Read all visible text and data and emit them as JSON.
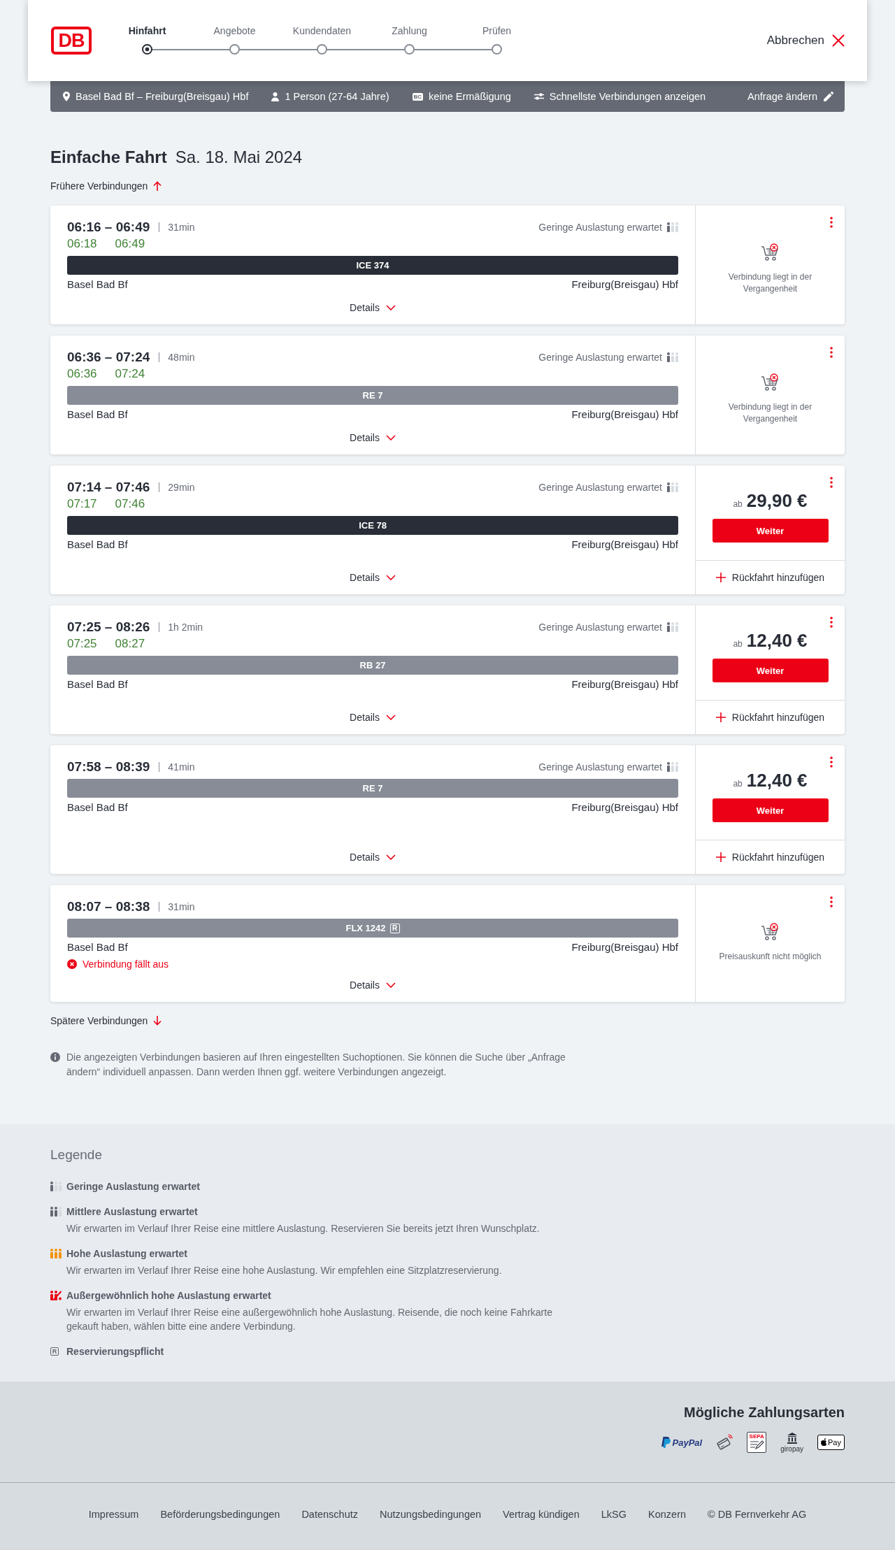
{
  "header": {
    "logo": "DB",
    "steps": [
      {
        "label": "Hinfahrt",
        "selected": true
      },
      {
        "label": "Angebote",
        "selected": false
      },
      {
        "label": "Kundendaten",
        "selected": false
      },
      {
        "label": "Zahlung",
        "selected": false
      },
      {
        "label": "Prüfen",
        "selected": false
      }
    ],
    "cancel": "Abbrechen"
  },
  "search_summary": {
    "route": "Basel Bad Bf – Freiburg(Breisgau) Hbf",
    "travellers": "1 Person (27-64 Jahre)",
    "discount_badge": "BC",
    "discount": "keine Ermäßigung",
    "option": "Schnellste Verbindungen anzeigen",
    "edit": "Anfrage ändern"
  },
  "title": "Einfache Fahrt",
  "date": "Sa. 18. Mai 2024",
  "earlier": "Frühere Verbindungen",
  "connections": [
    {
      "times": "06:16 – 06:49",
      "duration": "31min",
      "realtime": [
        "06:18",
        "06:49"
      ],
      "occupancy": {
        "kind": "low",
        "label": "Geringe Auslastung erwartet"
      },
      "train": {
        "name": "ICE 374",
        "color": "#282d37"
      },
      "from": "Basel Bad Bf",
      "to": "Freiburg(Breisgau) Hbf",
      "details": "Details",
      "offer": {
        "kind": "message",
        "text": "Verbindung liegt in der Vergangenheit"
      }
    },
    {
      "times": "06:36 – 07:24",
      "duration": "48min",
      "realtime": [
        "06:36",
        "07:24"
      ],
      "occupancy": {
        "kind": "low",
        "label": "Geringe Auslastung erwartet"
      },
      "train": {
        "name": "RE 7",
        "color": "#878c96"
      },
      "from": "Basel Bad Bf",
      "to": "Freiburg(Breisgau) Hbf",
      "details": "Details",
      "offer": {
        "kind": "message",
        "text": "Verbindung liegt in der Vergangenheit"
      }
    },
    {
      "times": "07:14 – 07:46",
      "duration": "29min",
      "realtime": [
        "07:17",
        "07:46"
      ],
      "occupancy": {
        "kind": "low",
        "label": "Geringe Auslastung erwartet"
      },
      "train": {
        "name": "ICE 78",
        "color": "#282d37"
      },
      "from": "Basel Bad Bf",
      "to": "Freiburg(Breisgau) Hbf",
      "details": "Details",
      "offer": {
        "kind": "price",
        "prefix": "ab",
        "price": "29,90 €",
        "button": "Weiter",
        "return_trip": "Rückfahrt hinzufügen"
      }
    },
    {
      "times": "07:25 – 08:26",
      "duration": "1h 2min",
      "realtime": [
        "07:25",
        "08:27"
      ],
      "occupancy": {
        "kind": "low",
        "label": "Geringe Auslastung erwartet"
      },
      "train": {
        "name": "RB 27",
        "color": "#878c96"
      },
      "from": "Basel Bad Bf",
      "to": "Freiburg(Breisgau) Hbf",
      "details": "Details",
      "offer": {
        "kind": "price",
        "prefix": "ab",
        "price": "12,40 €",
        "button": "Weiter",
        "return_trip": "Rückfahrt hinzufügen"
      }
    },
    {
      "times": "07:58 – 08:39",
      "duration": "41min",
      "occupancy": {
        "kind": "low",
        "label": "Geringe Auslastung erwartet"
      },
      "train": {
        "name": "RE 7",
        "color": "#878c96"
      },
      "from": "Basel Bad Bf",
      "to": "Freiburg(Breisgau) Hbf",
      "details": "Details",
      "offer": {
        "kind": "price",
        "prefix": "ab",
        "price": "12,40 €",
        "button": "Weiter",
        "return_trip": "Rückfahrt hinzufügen"
      }
    },
    {
      "times": "08:07 – 08:38",
      "duration": "31min",
      "train": {
        "name": "FLX 1242",
        "color": "#878c96",
        "reservation_mark": "R"
      },
      "from": "Basel Bad Bf",
      "to": "Freiburg(Breisgau) Hbf",
      "notice": "Verbindung fällt aus",
      "details": "Details",
      "offer": {
        "kind": "message",
        "text": "Preisauskunft nicht möglich"
      }
    }
  ],
  "later": "Spätere Verbindungen",
  "note": "Die angezeigten Verbindungen basieren auf Ihren eingestellten Suchoptionen. Sie können die Suche über „Anfrage ändern“ individuell anpassen. Dann werden Ihnen ggf. weitere Verbindungen angezeigt.",
  "legend": {
    "title": "Legende",
    "items": [
      {
        "kind": "low",
        "title": "Geringe Auslastung erwartet"
      },
      {
        "kind": "medium",
        "title": "Mittlere Auslastung erwartet",
        "description": "Wir erwarten im Verlauf Ihrer Reise eine mittlere Auslastung. Reservieren Sie bereits jetzt Ihren Wunschplatz."
      },
      {
        "kind": "high",
        "title": "Hohe Auslastung erwartet",
        "description": "Wir erwarten im Verlauf Ihrer Reise eine hohe Auslastung. Wir empfehlen eine Sitzplatzreservierung."
      },
      {
        "kind": "extreme",
        "title": "Außergewöhnlich hohe Auslastung erwartet",
        "description": "Wir erwarten im Verlauf Ihrer Reise eine außergewöhnlich hohe Auslastung. Reisende, die noch keine Fahrkarte gekauft haben, wählen bitte eine andere Verbindung."
      },
      {
        "kind": "reservation",
        "icon_text": "R",
        "title": "Reservierungspflicht"
      }
    ]
  },
  "payment": {
    "title": "Mögliche Zahlungsarten",
    "methods": [
      {
        "kind": "paypal",
        "label": "PayPal"
      },
      {
        "kind": "card"
      },
      {
        "kind": "sepa",
        "label": "SEPA"
      },
      {
        "kind": "giropay",
        "label": "giropay"
      },
      {
        "kind": "applepay",
        "label": "Pay"
      }
    ]
  },
  "footer_links": [
    "Impressum",
    "Beförderungsbedingungen",
    "Datenschutz",
    "Nutzungsbedingungen",
    "Vertrag kündigen",
    "LkSG",
    "Konzern",
    "© DB Fernverkehr AG"
  ]
}
